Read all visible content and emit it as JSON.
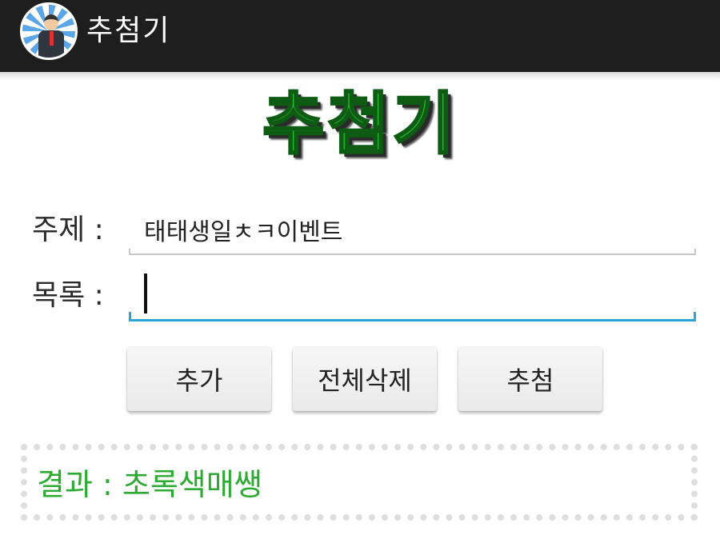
{
  "actionbar": {
    "app_title": "추첨기",
    "icon": "businessman-app-icon"
  },
  "main": {
    "big_title": "추첨기",
    "topic_label": "주제 :",
    "topic_value": "태태생일ㅊㅋ이벤트",
    "list_label": "목록 :",
    "list_input_value": "",
    "list_input_placeholder": ""
  },
  "buttons": {
    "add": "추가",
    "clear_all": "전체삭제",
    "draw": "추첨"
  },
  "result": {
    "text": "결과 : 초록색매쌩"
  },
  "colors": {
    "actionbar": "#1e1e1e",
    "title_green": "#22c233",
    "result_green": "#2daa32",
    "input_focus": "#2ea3d5"
  }
}
